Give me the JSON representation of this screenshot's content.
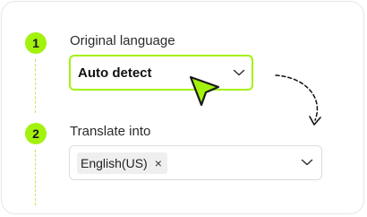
{
  "steps": [
    {
      "number": "1",
      "label": "Original language",
      "selected_value": "Auto detect"
    },
    {
      "number": "2",
      "label": "Translate into",
      "tags": [
        {
          "text": "English(US)",
          "remove_icon": "×"
        }
      ]
    }
  ],
  "icons": {
    "source_dropdown": "chevron-down-icon",
    "target_dropdown": "chevron-down-icon",
    "cursor": "pointer-cursor-icon",
    "flow": "dashed-curved-arrow-icon"
  },
  "colors": {
    "accent": "#a3f20e",
    "border": "#dcdcdc",
    "tag_bg": "#efefef",
    "text": "#2b2b2b"
  }
}
